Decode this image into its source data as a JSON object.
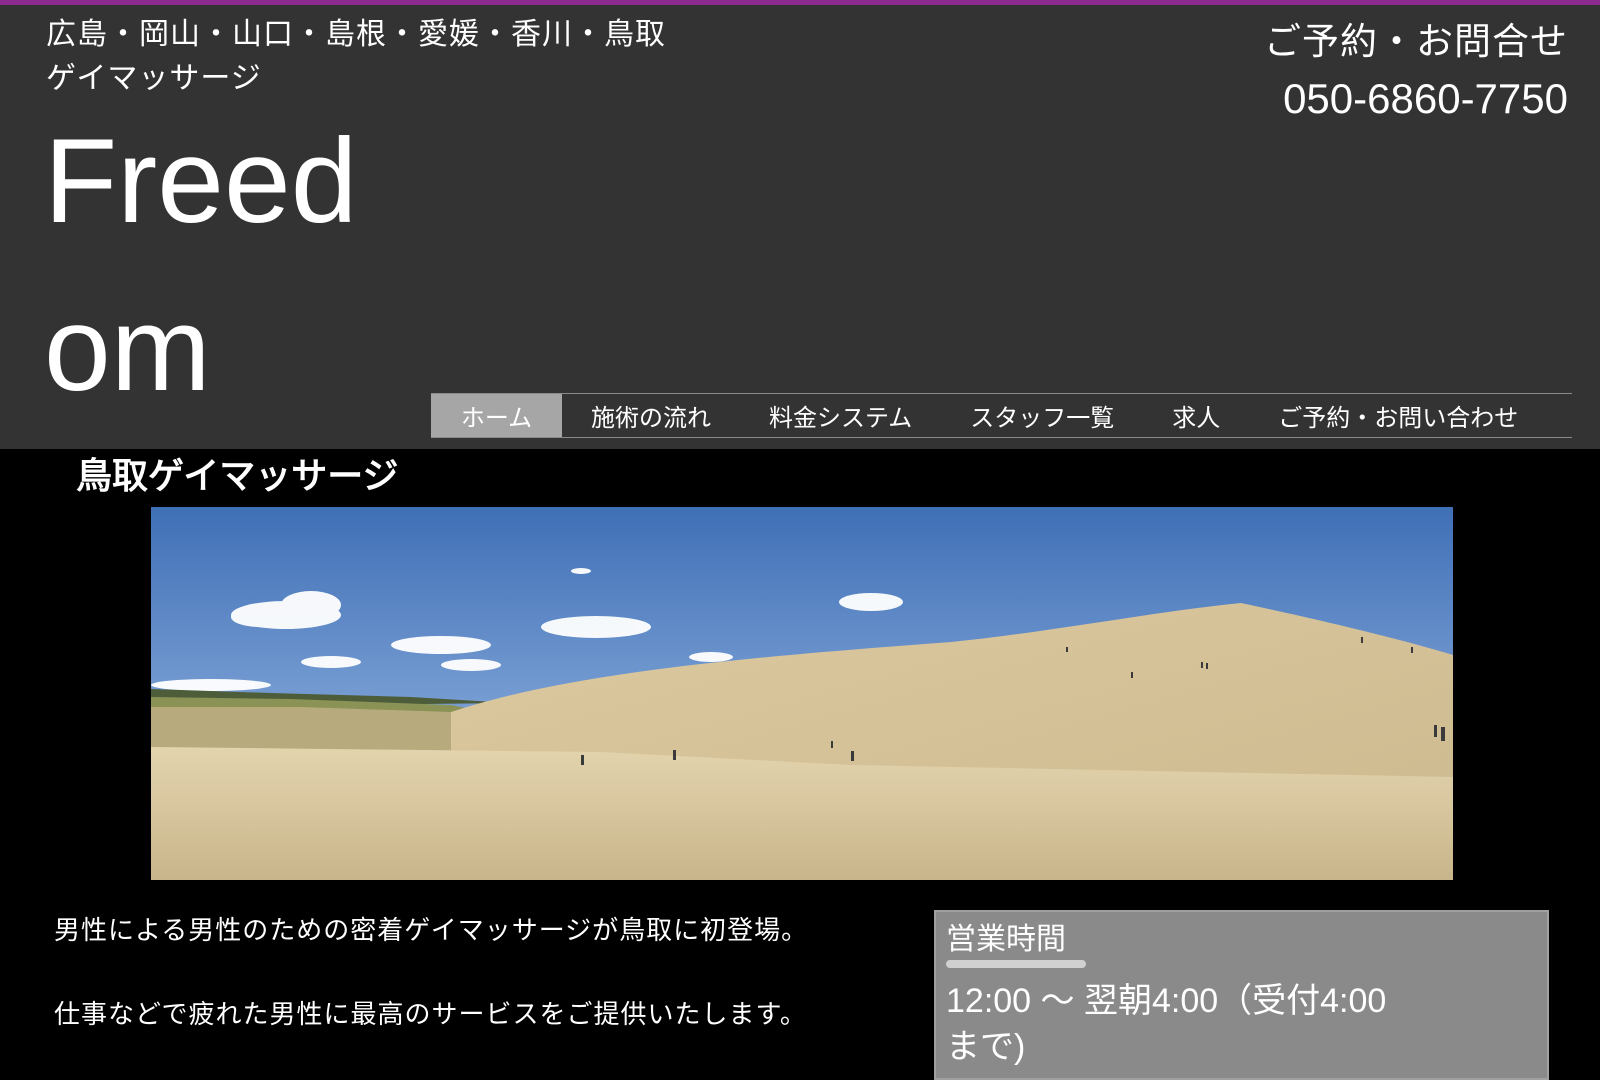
{
  "header": {
    "region_line1": "広島・岡山・山口・島根・愛媛・香川・鳥取",
    "region_line2": "ゲイマッサージ",
    "site_title": "Freedom",
    "contact_label": "ご予約・お問合せ",
    "contact_phone": "050-6860-7750"
  },
  "nav": {
    "items": [
      {
        "label": "ホーム",
        "active": true
      },
      {
        "label": "施術の流れ"
      },
      {
        "label": "料金システム"
      },
      {
        "label": "スタッフ一覧"
      },
      {
        "label": "求人"
      },
      {
        "label": "ご予約・お問い合わせ"
      }
    ]
  },
  "main": {
    "section_title": "鳥取ゲイマッサージ",
    "hero_image": "tottori-sand-dunes-panorama",
    "intro_lines": [
      "男性による男性のための密着ゲイマッサージが鳥取に初登場。",
      "仕事などで疲れた男性に最高のサービスをご提供いたします。"
    ]
  },
  "hours": {
    "title": "営業時間",
    "text": "12:00 〜 翌朝4:00（受付4:00まで)"
  },
  "colors": {
    "accent": "#8b2a8f",
    "header_bg": "#333333",
    "page_bg": "#000000",
    "nav_active": "#a6a6a6",
    "hours_bg": "#8a8a8a"
  }
}
